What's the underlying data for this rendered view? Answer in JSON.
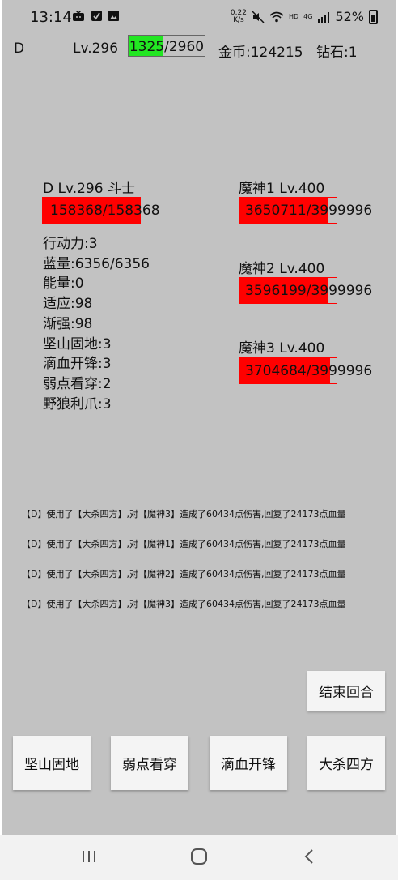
{
  "status_bar": {
    "time": "13:14",
    "net_speed": "0.22",
    "net_unit": "K/s",
    "hd": "HD",
    "signal": "4G",
    "battery": "52%"
  },
  "player_bar": {
    "name": "D",
    "level": "Lv.296",
    "exp_text": "1325/2960",
    "exp_fraction": 0.4476,
    "gold": "金币:124215",
    "diamond": "钻石:1"
  },
  "player": {
    "title": "D  Lv.296  斗士",
    "hp_text": "158368/158368",
    "hp_fraction": 1.0,
    "stats": [
      "行动力:3",
      "蓝量:6356/6356",
      "能量:0",
      "适应:98",
      "渐强:98",
      "坚山固地:3",
      "滴血开锋:3",
      "弱点看穿:2",
      "野狼利爪:3"
    ]
  },
  "enemies": [
    {
      "title": "魔神1  Lv.400",
      "hp_text": "3650711/3999996",
      "hp_fraction": 0.9127
    },
    {
      "title": "魔神2  Lv.400",
      "hp_text": "3596199/3999996",
      "hp_fraction": 0.899
    },
    {
      "title": "魔神3  Lv.400",
      "hp_text": "3704684/3999996",
      "hp_fraction": 0.9262
    }
  ],
  "battle_log": [
    "【D】使用了【大杀四方】,对【魔神3】造成了60434点伤害,回复了24173点血量",
    "【D】使用了【大杀四方】,对【魔神1】造成了60434点伤害,回复了24173点血量",
    "【D】使用了【大杀四方】,对【魔神2】造成了60434点伤害,回复了24173点血量",
    "【D】使用了【大杀四方】,对【魔神3】造成了60434点伤害,回复了24173点血量"
  ],
  "buttons": {
    "end_turn": "结束回合",
    "skills": [
      "坚山固地",
      "弱点看穿",
      "滴血开锋",
      "大杀四方"
    ]
  },
  "nav": {
    "recent": "recent-apps-icon",
    "home": "home-icon",
    "back": "back-icon"
  }
}
